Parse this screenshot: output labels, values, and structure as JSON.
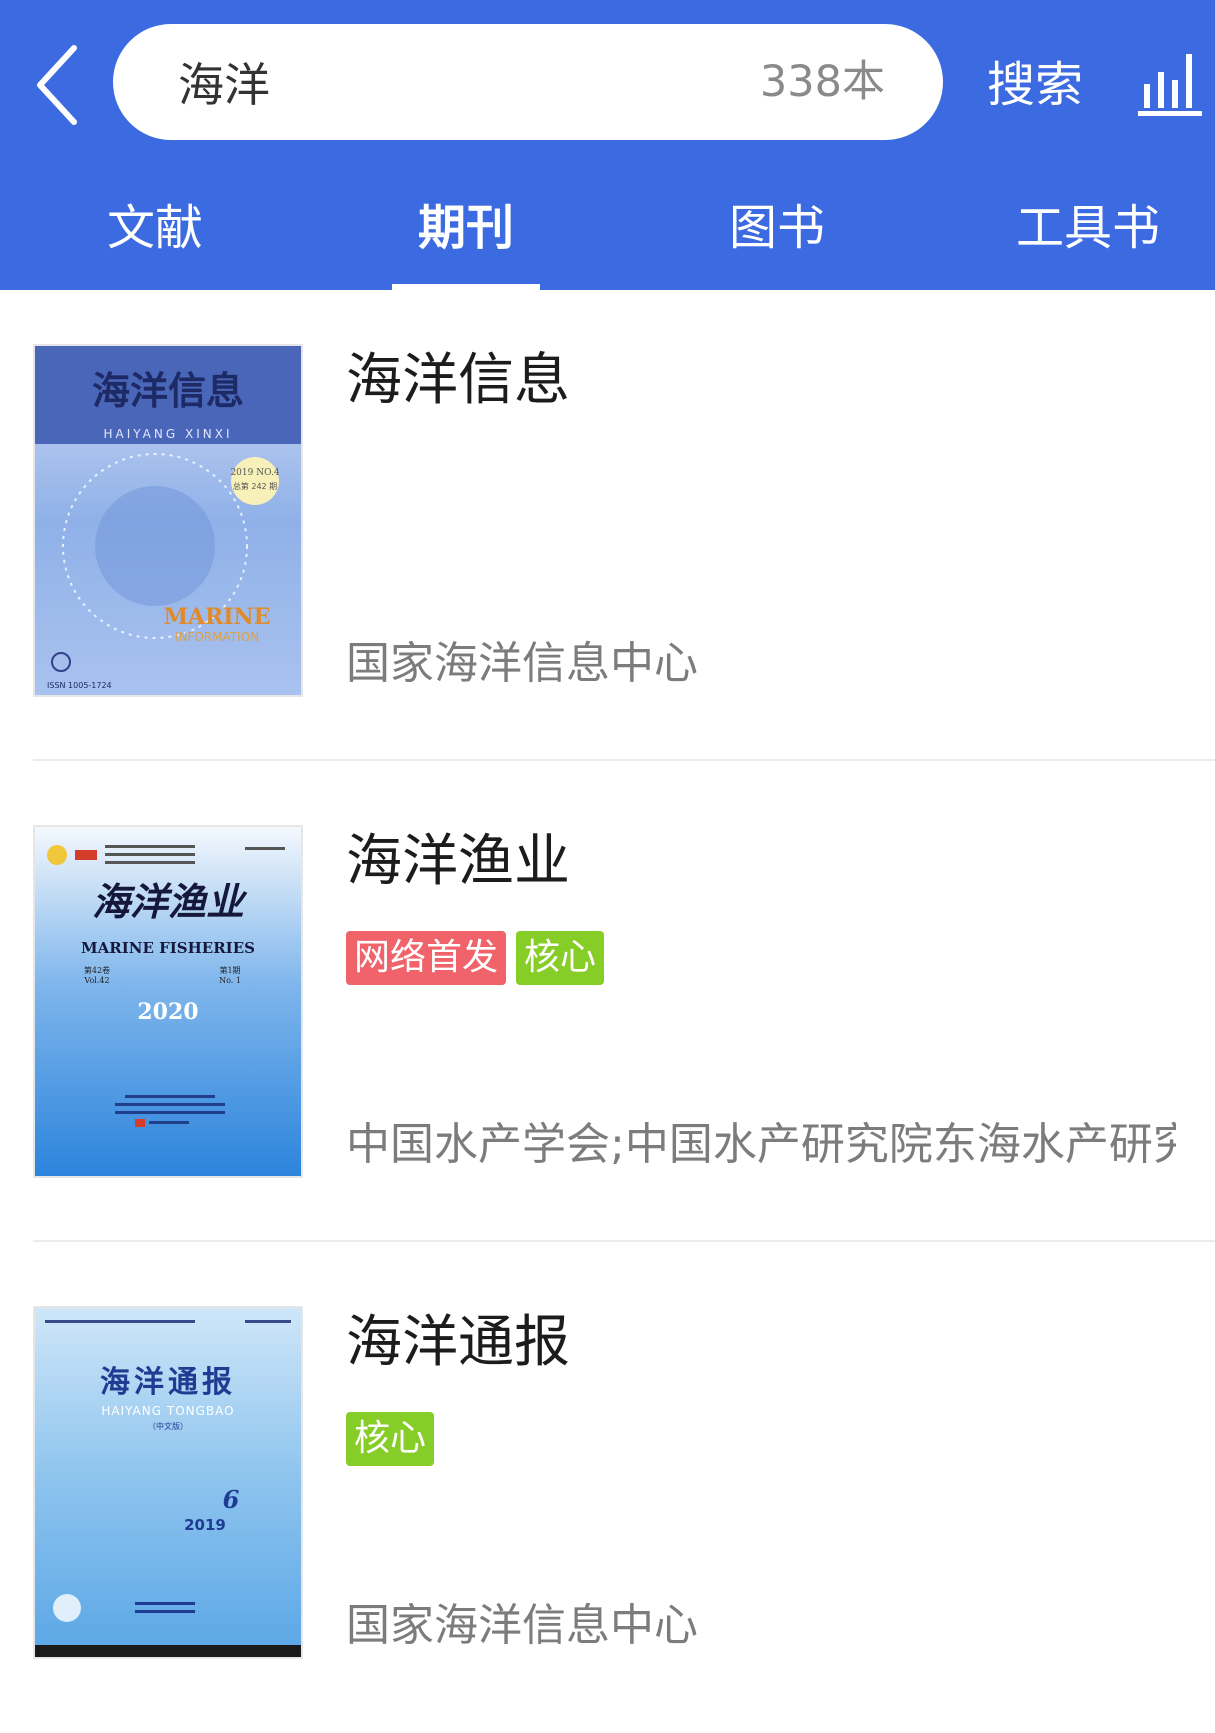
{
  "header": {
    "search_value": "海洋",
    "result_count": "338本",
    "search_label": "搜索",
    "back_icon": "chevron-left-icon",
    "stats_icon": "bar-chart-icon",
    "background_color": "#3c6ae0"
  },
  "tabs": [
    {
      "label": "文献",
      "active": false
    },
    {
      "label": "期刊",
      "active": true
    },
    {
      "label": "图书",
      "active": false
    },
    {
      "label": "工具书",
      "active": false
    }
  ],
  "journals": [
    {
      "title": "海洋信息",
      "tags": [],
      "publisher": "国家海洋信息中心",
      "cover": {
        "title_cn": "海洋信息",
        "title_pinyin": "HAIYANG XINXI",
        "issue": "2019 NO.4",
        "issue_total": "总第 242 期",
        "title_en_1": "MARINE",
        "title_en_2": "INFORMATION",
        "issn": "ISSN 1005-1724"
      }
    },
    {
      "title": "海洋渔业",
      "tags": [
        {
          "label": "网络首发",
          "color": "#f0636b"
        },
        {
          "label": "核心",
          "color": "#86cd27"
        }
      ],
      "publisher": "中国水产学会;中国水产研究院东海水产研究所",
      "cover": {
        "title_cn": "海洋渔业",
        "title_en": "MARINE FISHERIES",
        "volume": "第42卷",
        "volume_en": "Vol.42",
        "number": "第1期",
        "number_en": "No. 1",
        "year": "2020"
      }
    },
    {
      "title": "海洋通报",
      "tags": [
        {
          "label": "核心",
          "color": "#86cd27"
        }
      ],
      "publisher": "国家海洋信息中心",
      "cover": {
        "title_cn": "海洋通报",
        "title_pinyin": "HAIYANG TONGBAO",
        "edition": "（中文版）",
        "issue": "6",
        "year": "2019"
      }
    }
  ]
}
